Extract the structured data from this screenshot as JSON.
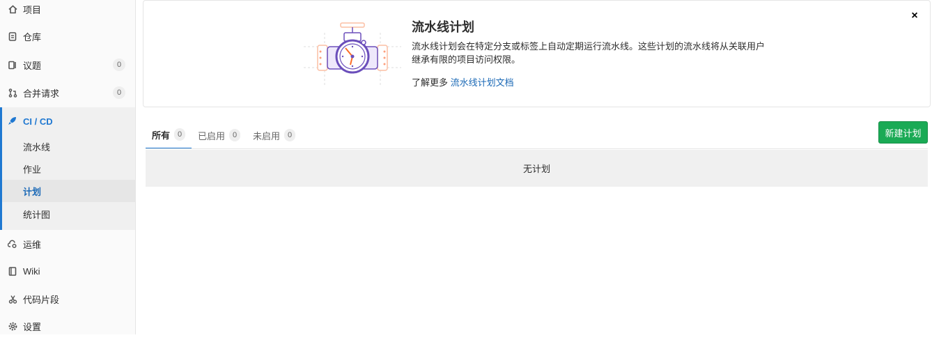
{
  "sidebar": {
    "items": [
      {
        "label": "项目",
        "icon": "home-icon"
      },
      {
        "label": "仓库",
        "icon": "doc-icon"
      },
      {
        "label": "议题",
        "icon": "issues-icon",
        "count": "0"
      },
      {
        "label": "合并请求",
        "icon": "merge-request-icon",
        "count": "0"
      },
      {
        "label": "运维",
        "icon": "cloud-gear-icon"
      },
      {
        "label": "Wiki",
        "icon": "book-icon"
      },
      {
        "label": "代码片段",
        "icon": "scissors-icon"
      },
      {
        "label": "设置",
        "icon": "gear-icon"
      }
    ],
    "cicd": {
      "label": "CI / CD",
      "icon": "rocket-icon",
      "sub": [
        {
          "label": "流水线"
        },
        {
          "label": "作业"
        },
        {
          "label": "计划",
          "active": true
        },
        {
          "label": "统计图"
        }
      ]
    }
  },
  "banner": {
    "title": "流水线计划",
    "description": "流水线计划会在特定分支或标签上自动定期运行流水线。这些计划的流水线将从关联用户继承有限的项目访问权限。",
    "more_prefix": "了解更多",
    "more_link": "流水线计划文档",
    "close_label": "×"
  },
  "tabs": [
    {
      "label": "所有",
      "count": "0",
      "active": true
    },
    {
      "label": "已启用",
      "count": "0"
    },
    {
      "label": "未启用",
      "count": "0"
    }
  ],
  "new_button": "新建计划",
  "empty_text": "无计划",
  "colors": {
    "accent": "#1f78d1",
    "button": "#1aaa55",
    "link": "#1b69b6"
  }
}
